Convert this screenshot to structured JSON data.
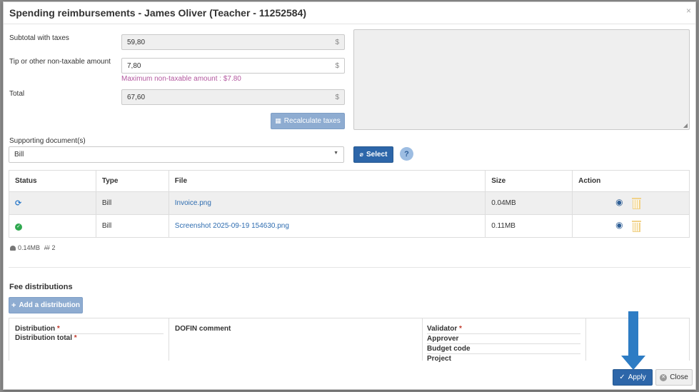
{
  "dialog": {
    "title": "Spending reimbursements - James Oliver (Teacher - 11252584)",
    "close_symbol": "×"
  },
  "form": {
    "subtotal_label": "Subtotal with taxes",
    "subtotal_value": "59,80",
    "tip_label": "Tip or other non-taxable amount",
    "tip_value": "7,80",
    "tip_hint": "Maximum non-taxable amount : $7.80",
    "total_label": "Total",
    "total_value": "67,60",
    "currency": "$",
    "recalc_label": "Recalculate taxes",
    "supporting_label": "Supporting document(s)",
    "supporting_selected": "Bill",
    "select_label": "Select",
    "help_label": "?"
  },
  "documents": {
    "headers": [
      "Status",
      "Type",
      "File",
      "Size",
      "Action"
    ],
    "rows": [
      {
        "status": "syncing",
        "type": "Bill",
        "file": "Invoice.png",
        "size": "0.04MB"
      },
      {
        "status": "ok",
        "type": "Bill",
        "file": "Screenshot 2025-09-19 154630.png",
        "size": "0.11MB"
      }
    ],
    "summary_size": "0.14MB",
    "summary_count": "2"
  },
  "fees": {
    "title": "Fee distributions",
    "add_label": "Add a distribution",
    "distribution_label": "Distribution",
    "distribution_total_label": "Distribution total",
    "dofin_label": "DOFIN comment",
    "validator_label": "Validator",
    "approver_label": "Approver",
    "budget_code_label": "Budget code",
    "project_label": "Project",
    "required_mark": "*"
  },
  "footer": {
    "apply_label": "Apply",
    "close_label": "Close"
  },
  "colors": {
    "primary": "#2d66a9",
    "primary_light": "#8eacd1",
    "hint": "#b3589f",
    "arrow": "#2d7cc4"
  }
}
